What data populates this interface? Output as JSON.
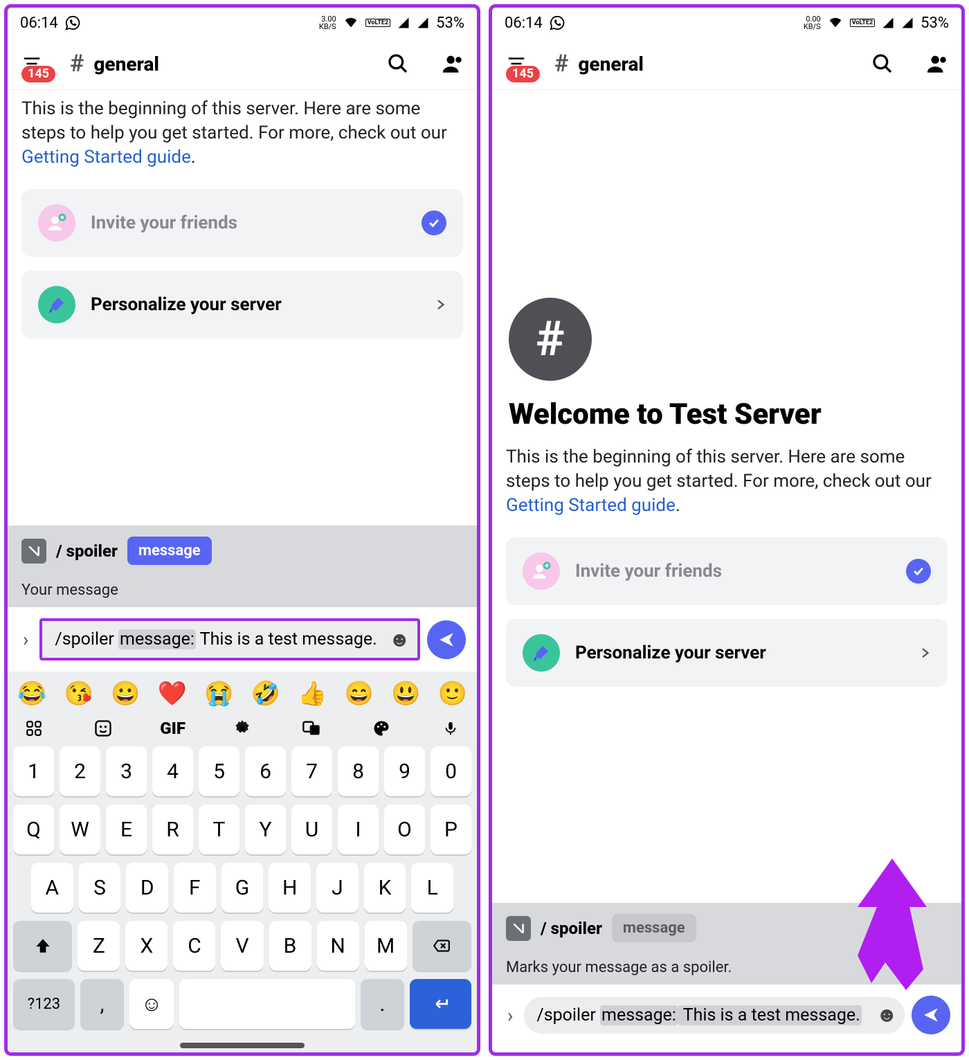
{
  "status": {
    "time": "06:14",
    "net1": "3.00",
    "net2": "0.00",
    "net_unit": "KB/S",
    "lte": "VoLTE2",
    "battery": "53%"
  },
  "header": {
    "notif_count": "145",
    "channel_name": "general"
  },
  "intro": {
    "text1": "This is the beginning of this server. Here are some steps to help you get started. For more, check out our ",
    "link": "Getting Started guide",
    "dot": "."
  },
  "cards": {
    "invite": "Invite your friends",
    "personalize": "Personalize your server"
  },
  "cmd": {
    "name": "/ spoiler",
    "arg": "message",
    "hint_left": "Your message",
    "hint_right": "Marks your message as a spoiler."
  },
  "input": {
    "prefix": "/spoiler ",
    "hl": "message:",
    "rest": " This is a test message."
  },
  "p2": {
    "welcome": "Welcome to Test Server"
  },
  "kbd": {
    "emojis": [
      "😂",
      "😘",
      "😀",
      "❤️",
      "😭",
      "🤣",
      "👍",
      "😄",
      "😃",
      "🙂"
    ],
    "gif": "GIF",
    "row_num": [
      "1",
      "2",
      "3",
      "4",
      "5",
      "6",
      "7",
      "8",
      "9",
      "0"
    ],
    "row_q": [
      "Q",
      "W",
      "E",
      "R",
      "T",
      "Y",
      "U",
      "I",
      "O",
      "P"
    ],
    "row_a": [
      "A",
      "S",
      "D",
      "F",
      "G",
      "H",
      "J",
      "K",
      "L"
    ],
    "row_z": [
      "Z",
      "X",
      "C",
      "V",
      "B",
      "N",
      "M"
    ],
    "sym": "?123",
    "comma": ",",
    "dot": "."
  }
}
